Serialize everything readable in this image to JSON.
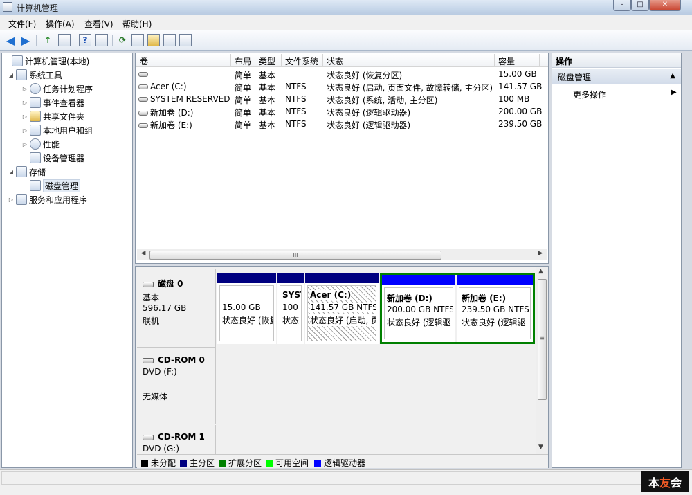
{
  "window": {
    "title": "计算机管理",
    "min": "–",
    "max": "□",
    "close": "✕"
  },
  "menu": [
    "文件(F)",
    "操作(A)",
    "查看(V)",
    "帮助(H)"
  ],
  "toolbar": {
    "back": "◀",
    "forward": "▶",
    "up": "↑",
    "help": "?",
    "refresh": "⟳"
  },
  "tree": [
    {
      "label": "计算机管理(本地)",
      "icon": "computer-icon",
      "indent": 0,
      "expander": ""
    },
    {
      "label": "系统工具",
      "icon": "tools-icon",
      "indent": 1,
      "expander": "◢"
    },
    {
      "label": "任务计划程序",
      "icon": "clock-icon",
      "indent": 2,
      "expander": "▷"
    },
    {
      "label": "事件查看器",
      "icon": "event-viewer-icon",
      "indent": 2,
      "expander": "▷"
    },
    {
      "label": "共享文件夹",
      "icon": "shared-folder-icon",
      "indent": 2,
      "expander": "▷"
    },
    {
      "label": "本地用户和组",
      "icon": "users-icon",
      "indent": 2,
      "expander": "▷"
    },
    {
      "label": "性能",
      "icon": "performance-icon",
      "indent": 2,
      "expander": "▷"
    },
    {
      "label": "设备管理器",
      "icon": "device-manager-icon",
      "indent": 2,
      "expander": ""
    },
    {
      "label": "存储",
      "icon": "storage-icon",
      "indent": 1,
      "expander": "◢"
    },
    {
      "label": "磁盘管理",
      "icon": "disk-management-icon",
      "indent": 2,
      "expander": "",
      "selected": true
    },
    {
      "label": "服务和应用程序",
      "icon": "services-icon",
      "indent": 1,
      "expander": "▷"
    }
  ],
  "volumes": {
    "columns": [
      "卷",
      "布局",
      "类型",
      "文件系统",
      "状态",
      "容量"
    ],
    "rows": [
      {
        "name": "",
        "layout": "简单",
        "type": "基本",
        "fs": "",
        "status": "状态良好 (恢复分区)",
        "capacity": "15.00 GB"
      },
      {
        "name": "Acer (C:)",
        "layout": "简单",
        "type": "基本",
        "fs": "NTFS",
        "status": "状态良好 (启动, 页面文件, 故障转储, 主分区)",
        "capacity": "141.57 GB"
      },
      {
        "name": "SYSTEM RESERVED",
        "layout": "简单",
        "type": "基本",
        "fs": "NTFS",
        "status": "状态良好 (系统, 活动, 主分区)",
        "capacity": "100 MB"
      },
      {
        "name": "新加卷 (D:)",
        "layout": "简单",
        "type": "基本",
        "fs": "NTFS",
        "status": "状态良好 (逻辑驱动器)",
        "capacity": "200.00 GB"
      },
      {
        "name": "新加卷 (E:)",
        "layout": "简单",
        "type": "基本",
        "fs": "NTFS",
        "status": "状态良好 (逻辑驱动器)",
        "capacity": "239.50 GB"
      }
    ],
    "scroll_grip": "III"
  },
  "disks": [
    {
      "name": "磁盘 0",
      "line1": "基本",
      "line2": "596.17 GB",
      "line3": "联机"
    },
    {
      "name": "CD-ROM 0",
      "line1": "DVD (F:)",
      "line2": "",
      "line3": "无媒体"
    },
    {
      "name": "CD-ROM 1",
      "line1": "DVD (G:)",
      "line2": "",
      "line3": ""
    }
  ],
  "partitions": [
    {
      "title": "",
      "size": "15.00 GB",
      "status": "状态良好 (恢复"
    },
    {
      "title": "SYST",
      "size": "100",
      "status": "状态"
    },
    {
      "title": "Acer (C:)",
      "size": "141.57 GB NTFS",
      "status": "状态良好 (启动, 页"
    },
    {
      "title": "新加卷 (D:)",
      "size": "200.00 GB NTFS",
      "status": "状态良好 (逻辑驱"
    },
    {
      "title": "新加卷 (E:)",
      "size": "239.50 GB NTFS",
      "status": "状态良好 (逻辑驱"
    }
  ],
  "legend": [
    {
      "label": "未分配",
      "color": "#000000"
    },
    {
      "label": "主分区",
      "color": "#000080"
    },
    {
      "label": "扩展分区",
      "color": "#008000"
    },
    {
      "label": "可用空间",
      "color": "#00ff00"
    },
    {
      "label": "逻辑驱动器",
      "color": "#0000ff"
    }
  ],
  "actions": {
    "header": "操作",
    "section": "磁盘管理",
    "section_caret": "▲",
    "more": "更多操作",
    "more_caret": "▶"
  },
  "watermark": {
    "part1": "本",
    "part2": "友",
    "part3": "会"
  }
}
